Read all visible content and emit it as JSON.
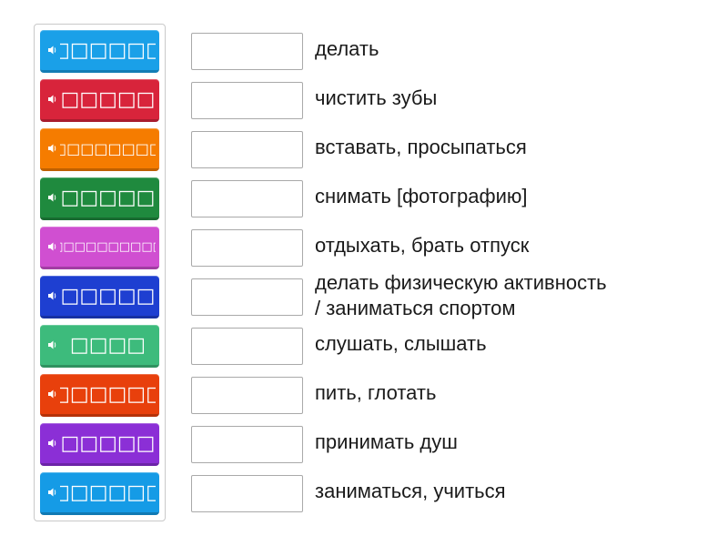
{
  "tiles": [
    {
      "label": "□□□□□□□□",
      "color": "#1aa0e8",
      "icon": "speaker-icon"
    },
    {
      "label": "□□□□□",
      "color": "#d8243b",
      "icon": "speaker-icon"
    },
    {
      "label": "□□□□□□□□□□",
      "color": "#f57c00",
      "icon": "speaker-icon"
    },
    {
      "label": "□□□□□",
      "color": "#1f8a3e",
      "icon": "speaker-icon"
    },
    {
      "label": "□□□□□□□□□□□□□□",
      "color": "#d04fd1",
      "icon": "speaker-icon"
    },
    {
      "label": "□□□□□",
      "color": "#1e3fd1",
      "icon": "speaker-icon"
    },
    {
      "label": "□□□□",
      "color": "#3dbb7c",
      "icon": "speaker-icon"
    },
    {
      "label": "□□□□□□□□",
      "color": "#e8400c",
      "icon": "speaker-icon"
    },
    {
      "label": "□□□□□□□□□",
      "color": "#8b2fd6",
      "icon": "speaker-icon"
    },
    {
      "label": "□□□□□□",
      "color": "#159be6",
      "icon": "speaker-icon"
    }
  ],
  "clues": [
    {
      "line1": "делать",
      "line2": ""
    },
    {
      "line1": "чистить зубы",
      "line2": ""
    },
    {
      "line1": "вставать, просыпаться",
      "line2": ""
    },
    {
      "line1": "снимать [фотографию]",
      "line2": ""
    },
    {
      "line1": "отдыхать, брать отпуск",
      "line2": ""
    },
    {
      "line1": "делать физическую активность",
      "line2": "/ заниматься спортом"
    },
    {
      "line1": "слушать, слышать",
      "line2": ""
    },
    {
      "line1": "пить, глотать",
      "line2": ""
    },
    {
      "line1": "принимать душ",
      "line2": ""
    },
    {
      "line1": "заниматься, учиться",
      "line2": ""
    }
  ]
}
